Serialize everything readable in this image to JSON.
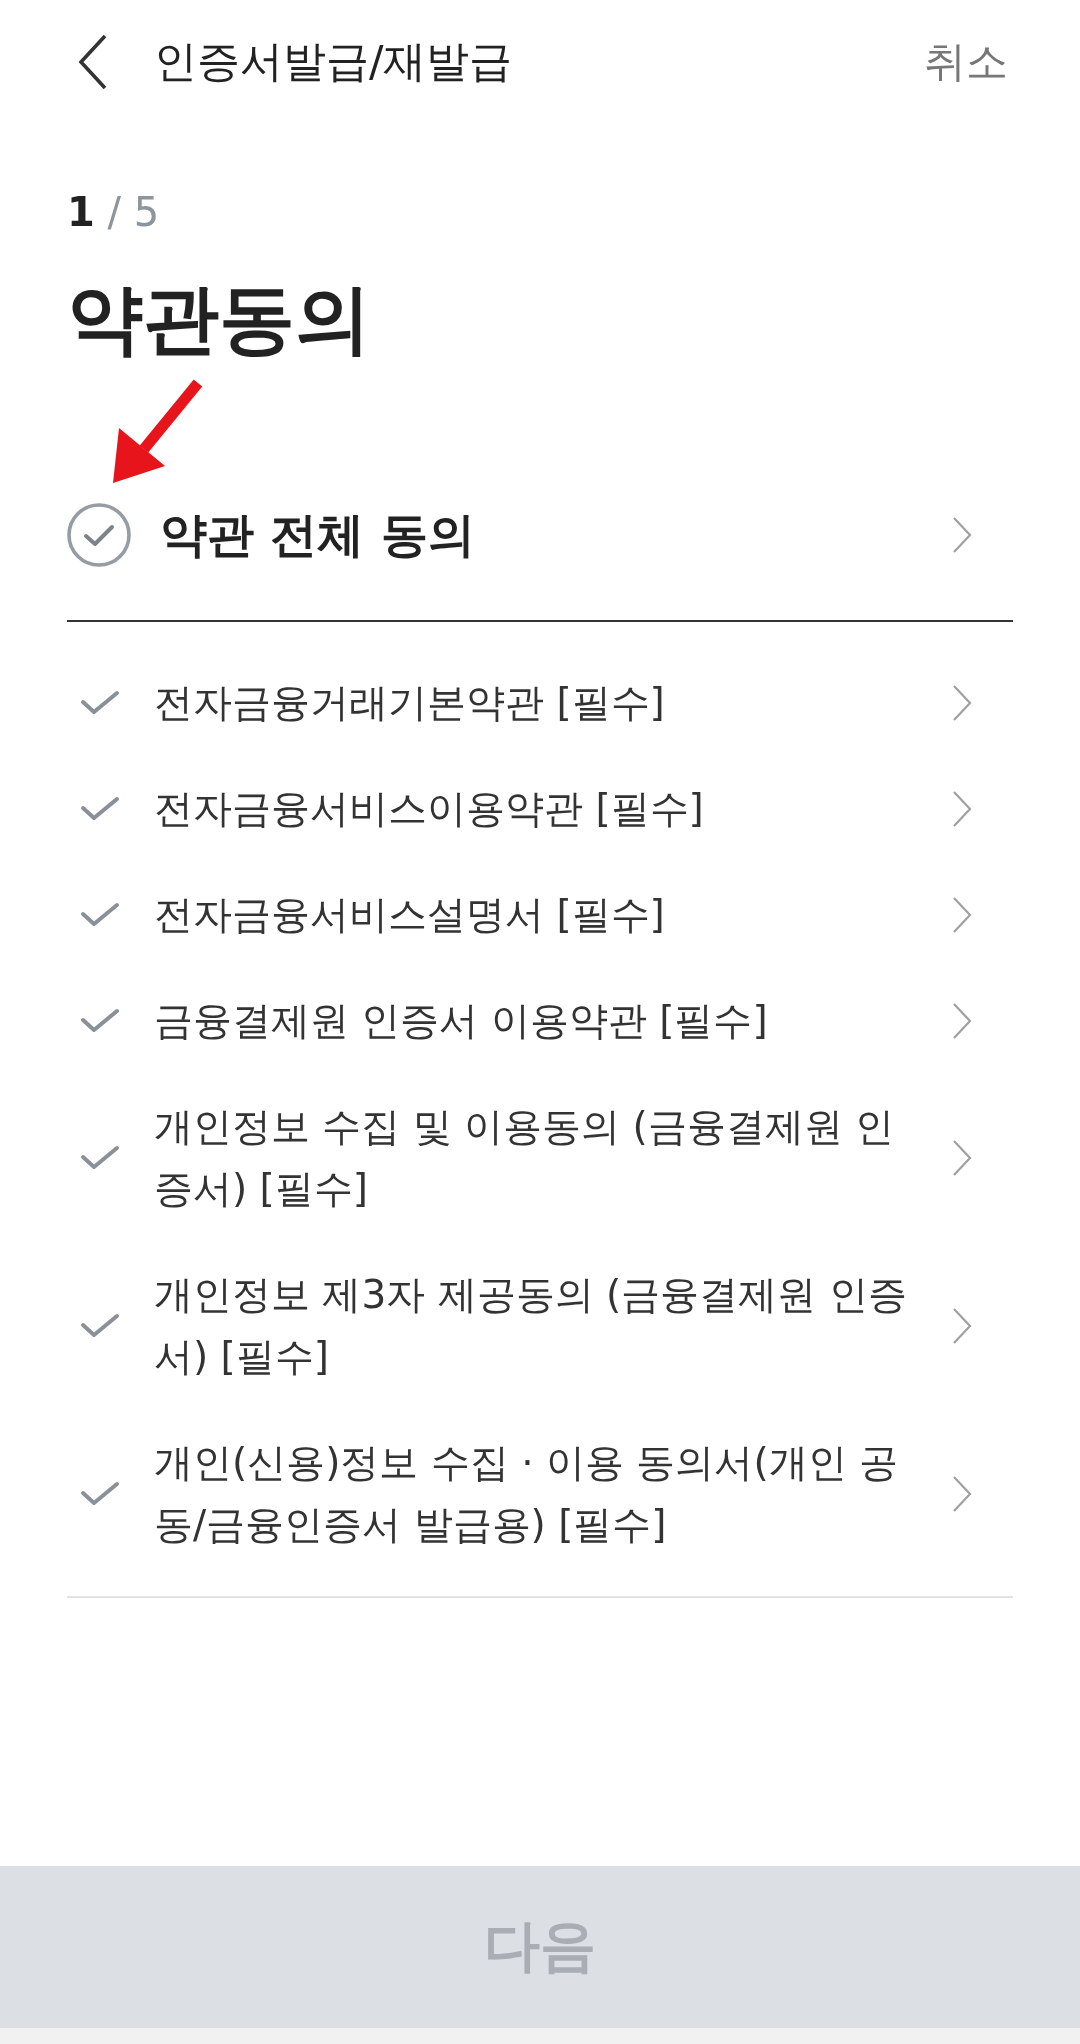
{
  "header": {
    "title": "인증서발급/재발급",
    "cancel": "취소"
  },
  "step_counter": "**1** / 5",
  "heading": "약관동의",
  "agree_all": {
    "label": "약관 전체 동의",
    "checked": false
  },
  "terms": [
    {
      "label": "전자금융거래기본약관 [필수]",
      "checked": false
    },
    {
      "label": "전자금융서비스이용약관 [필수]",
      "checked": false
    },
    {
      "label": "전자금융서비스설명서 [필수]",
      "checked": false
    },
    {
      "label": "금융결제원 인증서 이용약관 [필수]",
      "checked": false
    },
    {
      "label": "개인정보 수집 및 이용동의 (금융결제원 인증서) [필수]",
      "checked": false
    },
    {
      "label": "개인정보 제3자 제공동의 (금융결제원 인증서) [필수]",
      "checked": false
    },
    {
      "label": "개인(신용)정보 수집 · 이용 동의서(개인 공동/금융인증서 발급용) [필수]",
      "checked": false
    }
  ],
  "next_button": {
    "label": "다음",
    "disabled": true
  }
}
